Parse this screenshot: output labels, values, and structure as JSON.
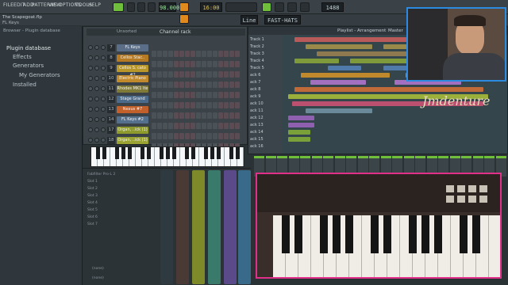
{
  "menu": [
    "FILE",
    "EDIT",
    "ADD",
    "PATTERNS",
    "VIEW",
    "OPTIONS",
    "TOOLS",
    "HELP"
  ],
  "project": {
    "name": "The Scapegoat.flp",
    "channel": "FL Keys"
  },
  "transport": {
    "tempo": "98.000",
    "pattern_time": "16:00",
    "mode": "Line",
    "snap": "FAST-HATS",
    "memory": "1488 MB"
  },
  "browser": {
    "title": "Browser - Plugin database",
    "items": [
      "Plugin database",
      "Effects",
      "Generators",
      "My Generators",
      "Installed"
    ]
  },
  "rack": {
    "title": "Channel rack",
    "filter": "Unsorted",
    "channels": [
      {
        "num": "7",
        "name": "FL Keys",
        "color": "#5a6e88"
      },
      {
        "num": "8",
        "name": "Cellos Stac..",
        "color": "#b67a22"
      },
      {
        "num": "9",
        "name": "Cellos S. cato #2",
        "color": "#b8962a"
      },
      {
        "num": "10",
        "name": "Electric Piano",
        "color": "#c08a2c"
      },
      {
        "num": "11",
        "name": "Rhodes MK1 Ite",
        "color": "#7f7a38"
      },
      {
        "num": "12",
        "name": "Stage Grand",
        "color": "#4c6a8a"
      },
      {
        "num": "13",
        "name": "Nexus #7",
        "color": "#c2602c"
      },
      {
        "num": "14",
        "name": "FL Keys #2",
        "color": "#55708c"
      },
      {
        "num": "17",
        "name": "Organ, ..ick (1)",
        "color": "#8e9a2c"
      },
      {
        "num": "18",
        "name": "Organ, ..ick (1)",
        "color": "#9aa232"
      }
    ]
  },
  "playlist": {
    "title": "Playlist - Arrangement",
    "pattern": "Master",
    "tracks": [
      "Track 1",
      "Track 2",
      "Track 3",
      "Track 4",
      "Track 5",
      "ack 6",
      "ack 7",
      "ack 8",
      "ack 9",
      "ack 10",
      "ack 11",
      "ack 12",
      "ack 13",
      "ack 14",
      "ack 15",
      "ack 16"
    ],
    "clips": [
      {
        "row": 0,
        "s": 0.05,
        "w": 0.55,
        "c": "#b85a5a"
      },
      {
        "row": 0,
        "s": 0.62,
        "w": 0.32,
        "c": "#b85a5a"
      },
      {
        "row": 1,
        "s": 0.1,
        "w": 0.3,
        "c": "#9a8a4a"
      },
      {
        "row": 1,
        "s": 0.45,
        "w": 0.4,
        "c": "#9a8a4a"
      },
      {
        "row": 2,
        "s": 0.15,
        "w": 0.7,
        "c": "#8f7a50"
      },
      {
        "row": 3,
        "s": 0.05,
        "w": 0.2,
        "c": "#7f9a3a"
      },
      {
        "row": 3,
        "s": 0.3,
        "w": 0.6,
        "c": "#7f9a3a"
      },
      {
        "row": 4,
        "s": 0.2,
        "w": 0.15,
        "c": "#4f7aaa"
      },
      {
        "row": 4,
        "s": 0.45,
        "w": 0.3,
        "c": "#4f7aaa"
      },
      {
        "row": 5,
        "s": 0.08,
        "w": 0.4,
        "c": "#c08a2c"
      },
      {
        "row": 5,
        "s": 0.55,
        "w": 0.35,
        "c": "#c08a2c"
      },
      {
        "row": 6,
        "s": 0.12,
        "w": 0.25,
        "c": "#a36fbf"
      },
      {
        "row": 6,
        "s": 0.5,
        "w": 0.3,
        "c": "#a36fbf"
      },
      {
        "row": 7,
        "s": 0.05,
        "w": 0.85,
        "c": "#c06a3a"
      },
      {
        "row": 8,
        "s": 0.02,
        "w": 0.9,
        "c": "#9bb03a"
      },
      {
        "row": 9,
        "s": 0.04,
        "w": 0.86,
        "c": "#bb5070"
      },
      {
        "row": 10,
        "s": 0.1,
        "w": 0.3,
        "c": "#6a8a9a"
      },
      {
        "row": 11,
        "s": 0.02,
        "w": 0.12,
        "c": "#9060b0"
      },
      {
        "row": 12,
        "s": 0.02,
        "w": 0.12,
        "c": "#9060b0"
      },
      {
        "row": 13,
        "s": 0.02,
        "w": 0.1,
        "c": "#7aa03a"
      },
      {
        "row": 14,
        "s": 0.02,
        "w": 0.1,
        "c": "#7aa03a"
      }
    ]
  },
  "mixer": {
    "slots": [
      "Fabfilter Pro-L 2",
      "Slot 1",
      "Slot 2",
      "Slot 3",
      "Slot 4",
      "Slot 5",
      "Slot 6",
      "Slot 7"
    ],
    "bottom": "(none)"
  },
  "watermark": "Jmdenture"
}
